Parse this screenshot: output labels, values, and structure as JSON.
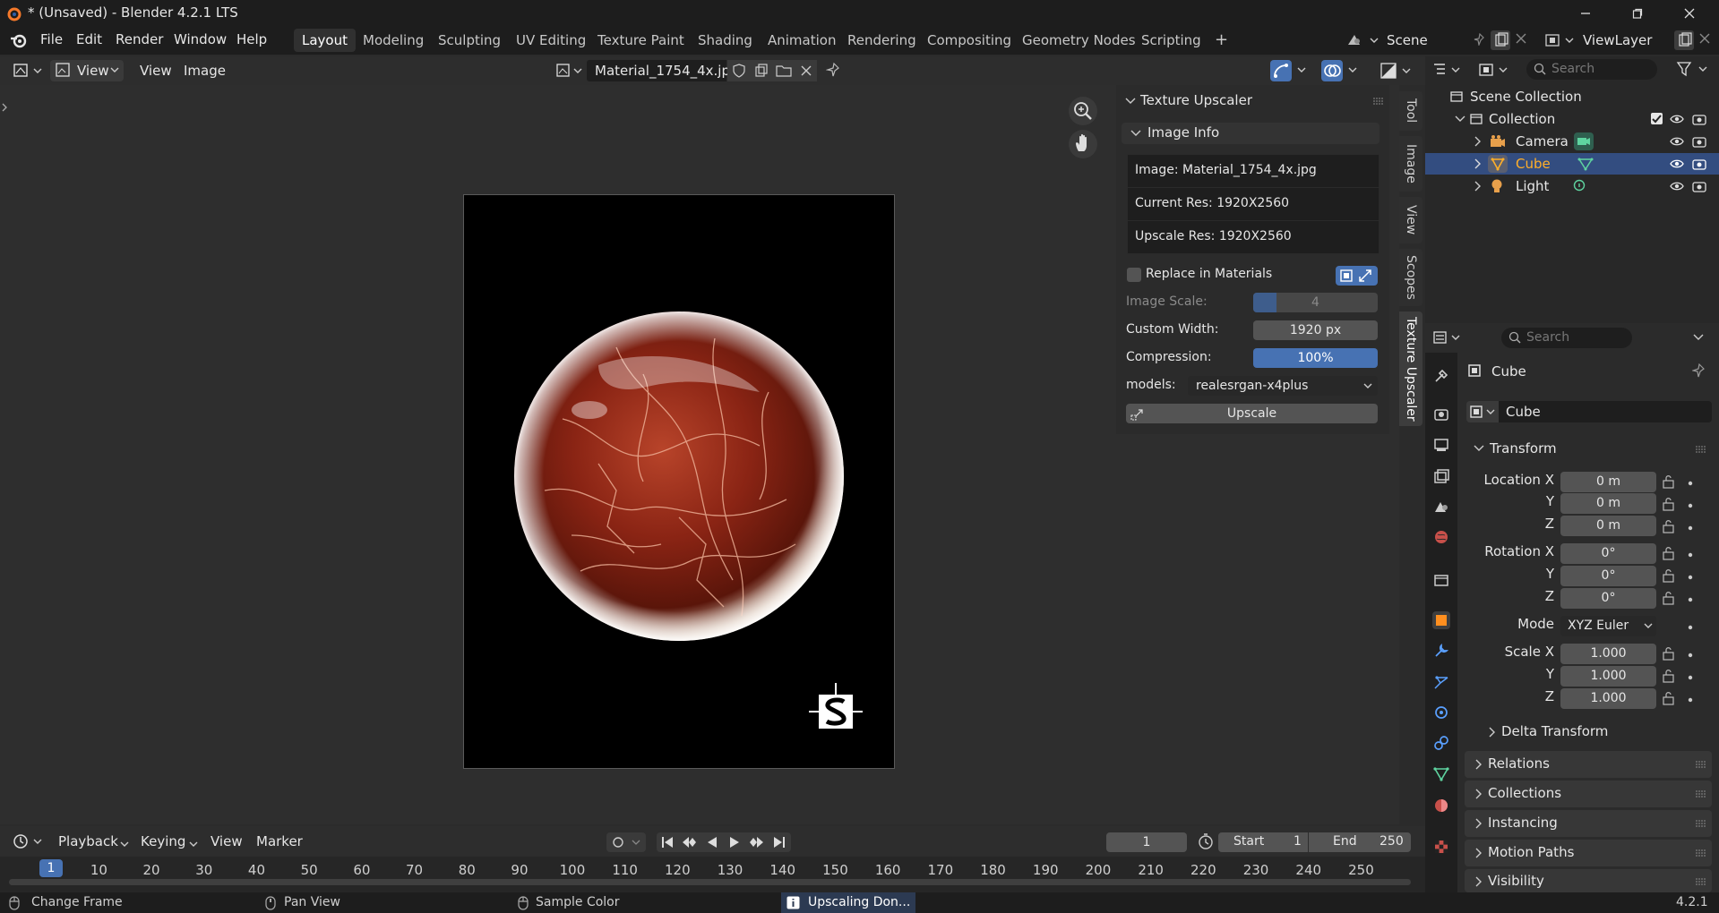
{
  "window": {
    "title": "* (Unsaved) - Blender 4.2.1 LTS"
  },
  "menubar": {
    "menus": [
      "File",
      "Edit",
      "Render",
      "Window",
      "Help"
    ],
    "workspaces": [
      "Layout",
      "Modeling",
      "Sculpting",
      "UV Editing",
      "Texture Paint",
      "Shading",
      "Animation",
      "Rendering",
      "Compositing",
      "Geometry Nodes",
      "Scripting"
    ],
    "active_workspace": "Layout",
    "add_tab": "+",
    "scene": "Scene",
    "view_layer": "ViewLayer"
  },
  "image_editor": {
    "view_menu": "View",
    "view_menu2": "View",
    "image_menu": "Image",
    "image_name": "Material_1754_4x.jpg"
  },
  "npanel": {
    "title": "Texture Upscaler",
    "subpanel": "Image Info",
    "image_line": "Image: Material_1754_4x.jpg",
    "current_res": "Current Res: 1920X2560",
    "upscale_res": "Upscale Res: 1920X2560",
    "replace_label": "Replace in Materials",
    "image_scale_label": "Image Scale:",
    "image_scale_value": "4",
    "custom_width_label": "Custom Width:",
    "custom_width_value": "1920 px",
    "compression_label": "Compression:",
    "compression_value": "100%",
    "models_label": "models:",
    "models_value": "realesrgan-x4plus",
    "upscale_button": "Upscale",
    "tabs": [
      "Tool",
      "Image",
      "View",
      "Scopes",
      "Texture Upscaler"
    ],
    "active_tab": "Texture Upscaler"
  },
  "outliner": {
    "search_placeholder": "Search",
    "root": "Scene Collection",
    "collection": "Collection",
    "items": [
      "Camera",
      "Cube",
      "Light"
    ],
    "selected": "Cube"
  },
  "properties": {
    "search_placeholder": "Search",
    "object_name": "Cube",
    "data_name": "Cube",
    "transform_title": "Transform",
    "location_label": "Location X",
    "location": [
      "0 m",
      "0 m",
      "0 m"
    ],
    "rotation_label": "Rotation X",
    "rotation": [
      "0°",
      "0°",
      "0°"
    ],
    "mode_label": "Mode",
    "mode_value": "XYZ Euler",
    "scale_label": "Scale X",
    "scale": [
      "1.000",
      "1.000",
      "1.000"
    ],
    "axis_y": "Y",
    "axis_z": "Z",
    "delta_transform": "Delta Transform",
    "sections": [
      "Relations",
      "Collections",
      "Instancing",
      "Motion Paths",
      "Visibility"
    ]
  },
  "timeline": {
    "menus": [
      "Playback",
      "Keying",
      "View",
      "Marker"
    ],
    "current_frame": "1",
    "start_label": "Start",
    "start_value": "1",
    "end_label": "End",
    "end_value": "250",
    "ruler_marker": "1",
    "ticks": [
      "10",
      "20",
      "30",
      "40",
      "50",
      "60",
      "70",
      "80",
      "90",
      "100",
      "110",
      "120",
      "130",
      "140",
      "150",
      "160",
      "170",
      "180",
      "190",
      "200",
      "210",
      "220",
      "230",
      "240",
      "250"
    ]
  },
  "statusbar": {
    "change_frame": "Change Frame",
    "pan_view": "Pan View",
    "sample_color": "Sample Color",
    "notification": "Upscaling Don...",
    "version": "4.2.1"
  },
  "colors": {
    "accent_blue": "#4772b3",
    "selected_orange": "#ffaf29",
    "header_dark": "#1d1d1d"
  }
}
